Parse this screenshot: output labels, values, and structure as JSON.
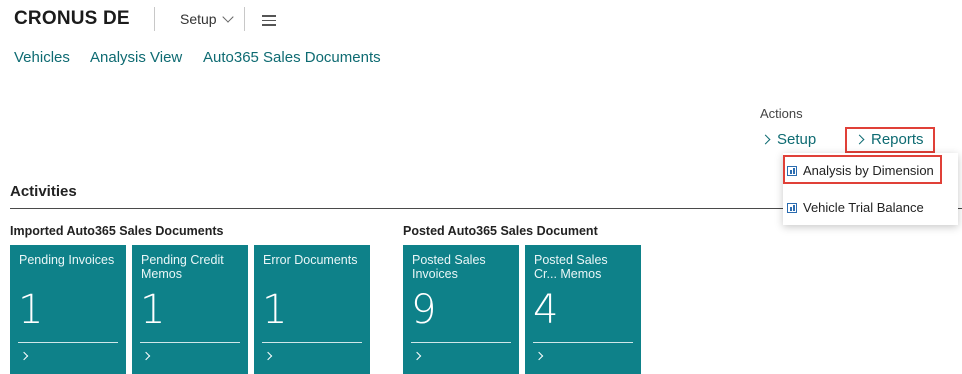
{
  "header": {
    "company": "CRONUS DE",
    "setup_menu": "Setup",
    "hamburger_icon": "hamburger-menu-icon"
  },
  "nav": {
    "links": [
      "Vehicles",
      "Analysis View",
      "Auto365 Sales Documents"
    ]
  },
  "actions": {
    "title": "Actions",
    "setup": "Setup",
    "reports": "Reports",
    "dropdown": [
      {
        "label": "Analysis by Dimension",
        "icon": "report-icon"
      },
      {
        "label": "Vehicle Trial Balance",
        "icon": "report-icon"
      }
    ]
  },
  "activities": {
    "title": "Activities",
    "groups": [
      {
        "title": "Imported Auto365 Sales Documents",
        "tiles": [
          {
            "label": "Pending Invoices",
            "value": "1"
          },
          {
            "label": "Pending Credit Memos",
            "value": "1"
          },
          {
            "label": "Error Documents",
            "value": "1"
          }
        ]
      },
      {
        "title": "Posted Auto365 Sales Document",
        "tiles": [
          {
            "label": "Posted Sales Invoices",
            "value": "9"
          },
          {
            "label": "Posted Sales Cr... Memos",
            "value": "4"
          }
        ]
      }
    ]
  },
  "colors": {
    "tile": "#0e8189",
    "link": "#0e6b72",
    "highlight": "#e04038"
  }
}
